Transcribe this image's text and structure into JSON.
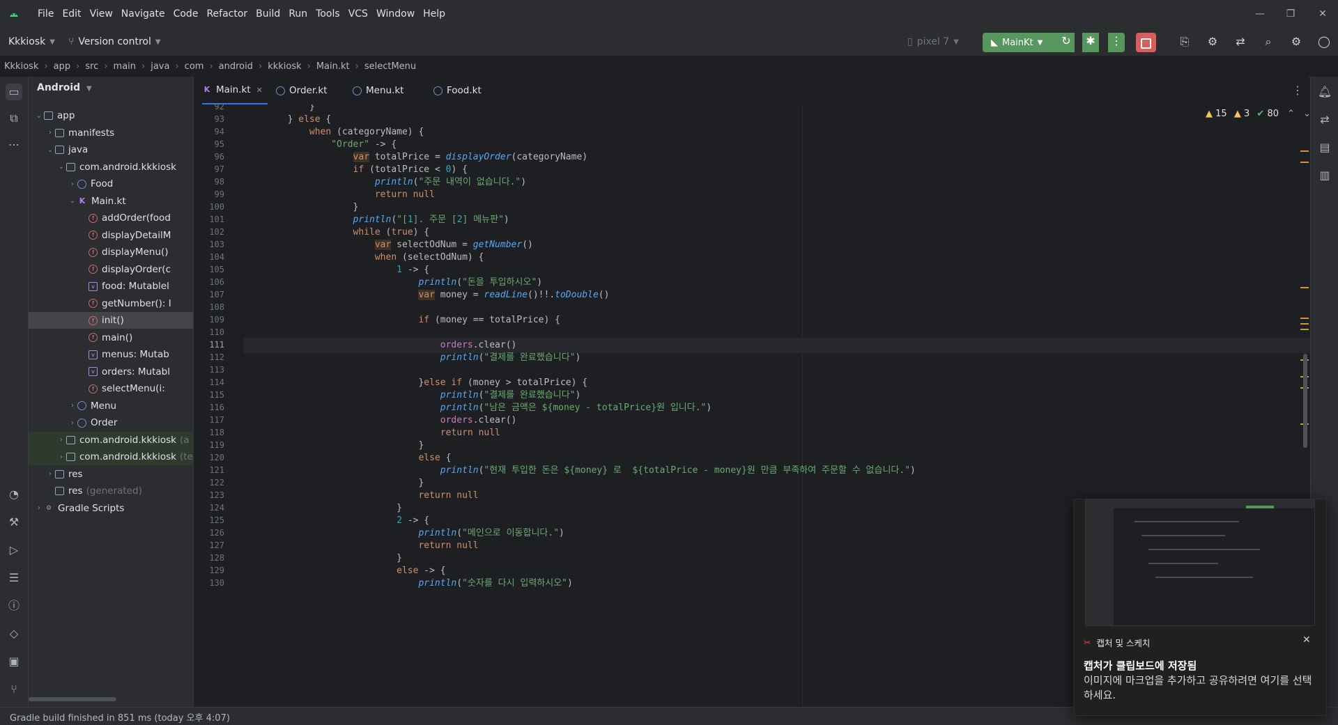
{
  "menubar": {
    "items": [
      "File",
      "Edit",
      "View",
      "Navigate",
      "Code",
      "Refactor",
      "Build",
      "Run",
      "Tools",
      "VCS",
      "Window",
      "Help"
    ]
  },
  "toolbar": {
    "project": "Kkkiosk",
    "vcs": "Version control",
    "device": "pixel 7",
    "run_config": "MainKt"
  },
  "breadcrumb": [
    "Kkkiosk",
    "app",
    "src",
    "main",
    "java",
    "com",
    "android",
    "kkkiosk",
    "Main.kt",
    "selectMenu"
  ],
  "project_panel": {
    "title": "Android",
    "rows": [
      {
        "label": "app",
        "extra": ""
      },
      {
        "label": "manifests",
        "extra": ""
      },
      {
        "label": "java",
        "extra": ""
      },
      {
        "label": "com.android.kkkiosk",
        "extra": ""
      },
      {
        "label": "Food",
        "extra": ""
      },
      {
        "label": "Main.kt",
        "extra": ""
      },
      {
        "label": "addOrder(food",
        "extra": ""
      },
      {
        "label": "displayDetailM",
        "extra": ""
      },
      {
        "label": "displayMenu()",
        "extra": ""
      },
      {
        "label": "displayOrder(c",
        "extra": ""
      },
      {
        "label": "food: Mutablel",
        "extra": ""
      },
      {
        "label": "getNumber(): I",
        "extra": ""
      },
      {
        "label": "init()",
        "extra": ""
      },
      {
        "label": "main()",
        "extra": ""
      },
      {
        "label": "menus: Mutab",
        "extra": ""
      },
      {
        "label": "orders: Mutabl",
        "extra": ""
      },
      {
        "label": "selectMenu(i:",
        "extra": ""
      },
      {
        "label": "Menu",
        "extra": ""
      },
      {
        "label": "Order",
        "extra": ""
      },
      {
        "label": "com.android.kkkiosk",
        "extra": "(a"
      },
      {
        "label": "com.android.kkkiosk",
        "extra": "(te"
      },
      {
        "label": "res",
        "extra": ""
      },
      {
        "label": "res",
        "extra": "(generated)"
      },
      {
        "label": "Gradle Scripts",
        "extra": ""
      }
    ]
  },
  "tabs": [
    "Main.kt",
    "Order.kt",
    "Menu.kt",
    "Food.kt"
  ],
  "inspections": {
    "warnings": "15",
    "weak": "3",
    "ok": "80"
  },
  "code_lines": [
    {
      "n": "92",
      "t": "            }"
    },
    {
      "n": "93",
      "t": "        } else {"
    },
    {
      "n": "94",
      "t": "            when (categoryName) {"
    },
    {
      "n": "95",
      "t": "                \"Order\" -> {"
    },
    {
      "n": "96",
      "t": "                    var totalPrice = displayOrder(categoryName)"
    },
    {
      "n": "97",
      "t": "                    if (totalPrice < 0) {"
    },
    {
      "n": "98",
      "t": "                        println(\"주문 내역이 없습니다.\")"
    },
    {
      "n": "99",
      "t": "                        return null"
    },
    {
      "n": "100",
      "t": "                    }"
    },
    {
      "n": "101",
      "t": "                    println(\"[1]. 주문 [2] 메뉴판\")"
    },
    {
      "n": "102",
      "t": "                    while (true) {"
    },
    {
      "n": "103",
      "t": "                        var selectOdNum = getNumber()"
    },
    {
      "n": "104",
      "t": "                        when (selectOdNum) {"
    },
    {
      "n": "105",
      "t": "                            1 -> {"
    },
    {
      "n": "106",
      "t": "                                println(\"돈을 투입하시오\")"
    },
    {
      "n": "107",
      "t": "                                var money = readLine()!!.toDouble()"
    },
    {
      "n": "108",
      "t": ""
    },
    {
      "n": "109",
      "t": "                                if (money == totalPrice) {"
    },
    {
      "n": "110",
      "t": ""
    },
    {
      "n": "111",
      "t": "                                    orders.clear()"
    },
    {
      "n": "112",
      "t": "                                    println(\"결제를 완료했습니다\")"
    },
    {
      "n": "113",
      "t": ""
    },
    {
      "n": "114",
      "t": "                                }else if (money > totalPrice) {"
    },
    {
      "n": "115",
      "t": "                                    println(\"결제를 완료했습니다\")"
    },
    {
      "n": "116",
      "t": "                                    println(\"남은 금액은 ${money - totalPrice}원 입니다.\")"
    },
    {
      "n": "117",
      "t": "                                    orders.clear()"
    },
    {
      "n": "118",
      "t": "                                    return null"
    },
    {
      "n": "119",
      "t": "                                }"
    },
    {
      "n": "120",
      "t": "                                else {"
    },
    {
      "n": "121",
      "t": "                                    println(\"현재 투입한 돈은 ${money} 로  ${totalPrice - money}원 만큼 부족하여 주문할 수 없습니다.\")"
    },
    {
      "n": "122",
      "t": "                                }"
    },
    {
      "n": "123",
      "t": "                                return null"
    },
    {
      "n": "124",
      "t": "                            }"
    },
    {
      "n": "125",
      "t": "                            2 -> {"
    },
    {
      "n": "126",
      "t": "                                println(\"메인으로 이동합니다.\")"
    },
    {
      "n": "127",
      "t": "                                return null"
    },
    {
      "n": "128",
      "t": "                            }"
    },
    {
      "n": "129",
      "t": "                            else -> {"
    },
    {
      "n": "130",
      "t": "                                println(\"숫자를 다시 입력하시오\")"
    }
  ],
  "status": {
    "message": "Gradle build finished in 851 ms (today 오후 4:07)"
  },
  "toast": {
    "app_name": "캡처 및 스케치",
    "title": "캡처가 클립보드에 저장됨",
    "body": "이미지에 마크업을 추가하고 공유하려면 여기를 선택하세요."
  },
  "colors": {
    "accent": "#3574f0",
    "run": "#57965c",
    "stop": "#db5c5c",
    "keyword": "#cf8e6d",
    "string": "#6aab73"
  }
}
